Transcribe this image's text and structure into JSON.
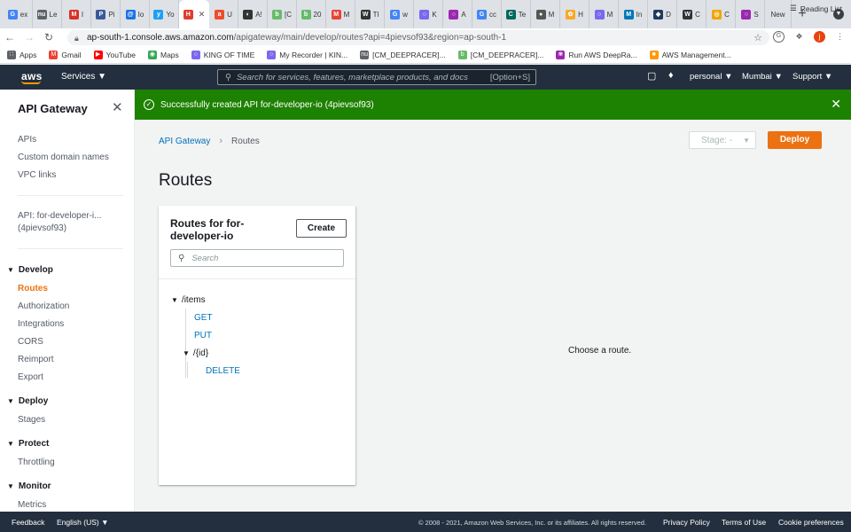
{
  "browser": {
    "tabs": [
      {
        "letter": "G",
        "label": "ex",
        "color": "#4285f4"
      },
      {
        "letter": "nu",
        "label": "Le",
        "color": "#5f6368"
      },
      {
        "letter": "M",
        "label": "I",
        "color": "#d93025"
      },
      {
        "letter": "P",
        "label": "Pi",
        "color": "#3b5998"
      },
      {
        "letter": "@",
        "label": "Io",
        "color": "#1a73e8"
      },
      {
        "letter": "y",
        "label": "Yo",
        "color": "#1da1f2"
      },
      {
        "letter": "H",
        "label": "",
        "color": "#e03e2d",
        "active": true
      },
      {
        "letter": "a",
        "label": "U",
        "color": "#ed4c2e"
      },
      {
        "letter": "◐",
        "label": "A!",
        "color": "#333"
      },
      {
        "letter": "b",
        "label": "[C",
        "color": "#66bb6a"
      },
      {
        "letter": "b",
        "label": "20",
        "color": "#66bb6a"
      },
      {
        "letter": "M",
        "label": "M",
        "color": "#ea4335"
      },
      {
        "letter": "W",
        "label": "Tl",
        "color": "#333"
      },
      {
        "letter": "G",
        "label": "w",
        "color": "#4285f4"
      },
      {
        "letter": "○",
        "label": "K",
        "color": "#7b68ee"
      },
      {
        "letter": "○",
        "label": "A",
        "color": "#9c27b0"
      },
      {
        "letter": "G",
        "label": "cc",
        "color": "#4285f4"
      },
      {
        "letter": "C",
        "label": "Te",
        "color": "#00695c"
      },
      {
        "letter": "●",
        "label": "M",
        "color": "#555"
      },
      {
        "letter": "✿",
        "label": "H",
        "color": "#f9a825"
      },
      {
        "letter": "○",
        "label": "M",
        "color": "#7b68ee"
      },
      {
        "letter": "M",
        "label": "In",
        "color": "#0077b5"
      },
      {
        "letter": "◆",
        "label": "D",
        "color": "#1e3a5f"
      },
      {
        "letter": "W",
        "label": "C",
        "color": "#333"
      },
      {
        "letter": "◎",
        "label": "C",
        "color": "#f0a500"
      },
      {
        "letter": "○",
        "label": "S",
        "color": "#9c27b0"
      },
      {
        "letter": "",
        "label": "New",
        "color": "#dee1e6"
      }
    ],
    "url_host": "ap-south-1.console.aws.amazon.com",
    "url_path": "/apigateway/main/develop/routes?api=4pievsof93&region=ap-south-1",
    "avatar_letter": "j",
    "bookmarks": [
      {
        "label": "Apps",
        "color": "#5f6368",
        "icon": "∷"
      },
      {
        "label": "Gmail",
        "color": "#ea4335",
        "icon": "M"
      },
      {
        "label": "YouTube",
        "color": "#ff0000",
        "icon": "▶"
      },
      {
        "label": "Maps",
        "color": "#34a853",
        "icon": "◉"
      },
      {
        "label": "KING OF TIME",
        "color": "#7b68ee",
        "icon": "○"
      },
      {
        "label": "My Recorder | KIN...",
        "color": "#7b68ee",
        "icon": "○"
      },
      {
        "label": "[CM_DEEPRACER]...",
        "color": "#5f6368",
        "icon": "nu"
      },
      {
        "label": "[CM_DEEPRACER]...",
        "color": "#66bb6a",
        "icon": "b"
      },
      {
        "label": "Run AWS DeepRa...",
        "color": "#9c27b0",
        "icon": "❀"
      },
      {
        "label": "AWS Management...",
        "color": "#ff9900",
        "icon": "■"
      }
    ],
    "reading_list": "Reading List"
  },
  "aws": {
    "logo": "aws",
    "services": "Services",
    "search_placeholder": "Search for services, features, marketplace products, and docs",
    "search_shortcut": "[Option+S]",
    "account": "personal",
    "region": "Mumbai",
    "support": "Support"
  },
  "sidebar": {
    "title": "API Gateway",
    "top_links": [
      "APIs",
      "Custom domain names",
      "VPC links"
    ],
    "api_label_1": "API: for-developer-i...",
    "api_label_2": "(4pievsof93)",
    "sections": [
      {
        "title": "Develop",
        "items": [
          {
            "label": "Routes",
            "active": true
          },
          {
            "label": "Authorization"
          },
          {
            "label": "Integrations"
          },
          {
            "label": "CORS"
          },
          {
            "label": "Reimport"
          },
          {
            "label": "Export"
          }
        ]
      },
      {
        "title": "Deploy",
        "items": [
          {
            "label": "Stages"
          }
        ]
      },
      {
        "title": "Protect",
        "items": [
          {
            "label": "Throttling"
          }
        ]
      },
      {
        "title": "Monitor",
        "items": [
          {
            "label": "Metrics"
          }
        ]
      }
    ]
  },
  "banner": {
    "message": "Successfully created API for-developer-io (4pievsof93)"
  },
  "main": {
    "breadcrumb_root": "API Gateway",
    "breadcrumb_current": "Routes",
    "stage_label": "Stage: -",
    "deploy_label": "Deploy",
    "title": "Routes",
    "panel": {
      "title": "Routes for for-developer-io",
      "create_label": "Create",
      "search_placeholder": "Search",
      "routes": [
        {
          "kind": "resource",
          "label": "/items",
          "depth": 0
        },
        {
          "kind": "method",
          "label": "GET",
          "depth": 1
        },
        {
          "kind": "method",
          "label": "PUT",
          "depth": 1
        },
        {
          "kind": "resource",
          "label": "/{id}",
          "depth": 1
        },
        {
          "kind": "method",
          "label": "DELETE",
          "depth": 2
        }
      ]
    },
    "empty_state": "Choose a route."
  },
  "footer": {
    "feedback": "Feedback",
    "language": "English (US)",
    "copyright": "© 2008 - 2021, Amazon Web Services, Inc. or its affiliates. All rights reserved.",
    "privacy": "Privacy Policy",
    "terms": "Terms of Use",
    "cookies": "Cookie preferences"
  },
  "colors": {
    "aws_nav": "#232f3e",
    "success": "#1d8102",
    "primary_button": "#ec7211",
    "link": "#0073bb"
  }
}
